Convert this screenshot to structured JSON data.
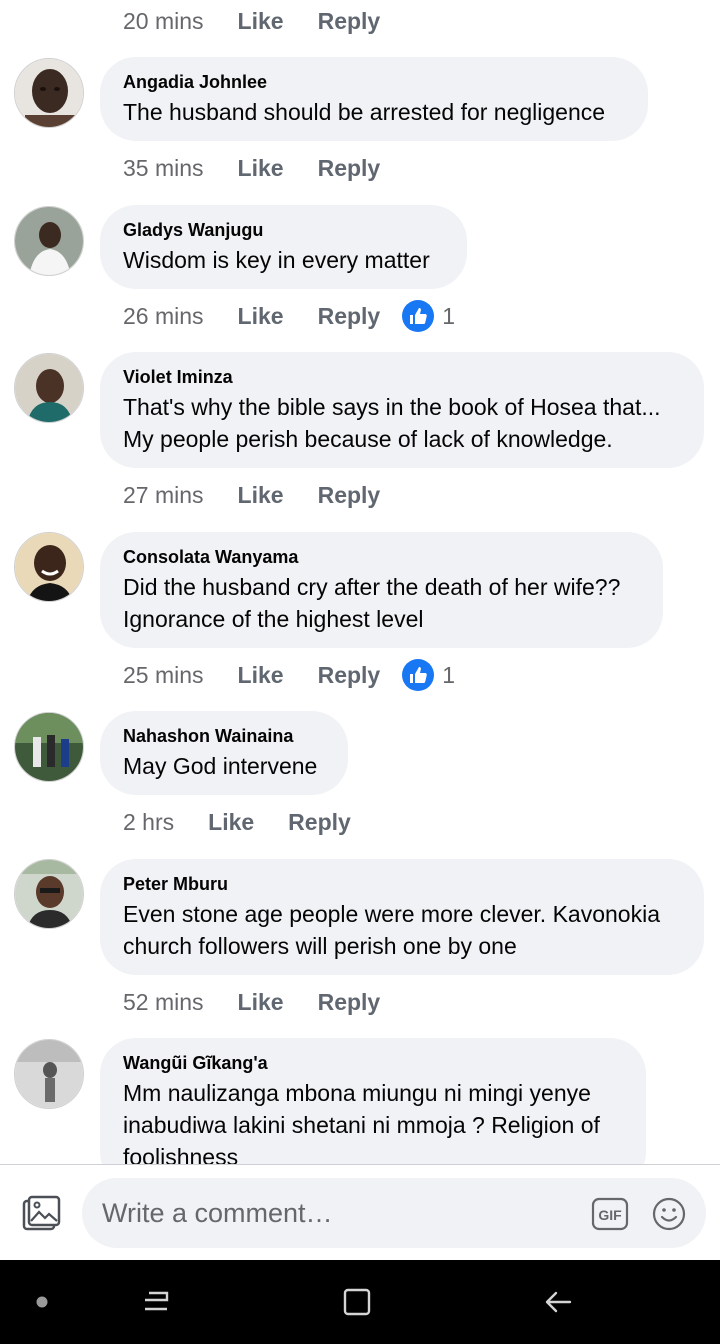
{
  "thread": {
    "like_label": "Like",
    "reply_label": "Reply",
    "top_row": {
      "time": "20 mins"
    },
    "comments": [
      {
        "name": "Angadia Johnlee",
        "text": [
          "The husband should be arrested for negligence"
        ],
        "time": "35 mins",
        "reactions": ""
      },
      {
        "name": "Gladys Wanjugu",
        "text": [
          "Wisdom is key in every matter"
        ],
        "time": "26 mins",
        "reactions": "1"
      },
      {
        "name": "Violet Iminza",
        "text": [
          "That's why the bible says in the book of Hosea that...",
          "My people perish because of lack of knowledge."
        ],
        "time": "27 mins",
        "reactions": ""
      },
      {
        "name": "Consolata Wanyama",
        "text": [
          "Did the husband cry after the death of her wife??",
          "Ignorance of the highest level"
        ],
        "time": "25 mins",
        "reactions": "1"
      },
      {
        "name": "Nahashon Wainaina",
        "text": [
          "May God intervene"
        ],
        "time": "2 hrs",
        "reactions": ""
      },
      {
        "name": "Peter Mburu",
        "text": [
          "Even stone age people were more clever. Kavonokia",
          "church followers will perish one by one"
        ],
        "time": "52 mins",
        "reactions": ""
      },
      {
        "name": "Wangũi Gĩkang'a",
        "text": [
          "Mm naulizanga mbona miungu ni mingi yenye",
          "inabudiwa lakini shetani ni mmoja ? Religion of",
          "foolishness"
        ],
        "time": "",
        "reactions": ""
      }
    ]
  },
  "composer": {
    "placeholder": "Write a comment…",
    "gif_label": "GIF",
    "icons": {
      "photo": "photo-icon",
      "gif": "gif-icon",
      "emoji": "emoji-icon"
    }
  },
  "navbar": {
    "icons": [
      "dot-icon",
      "recent-apps-icon",
      "home-icon",
      "back-icon"
    ]
  },
  "colors": {
    "bubble": "#f0f2f5",
    "meta_text": "#65676b",
    "like_blue": "#1877f2",
    "navbar": "#000000"
  }
}
